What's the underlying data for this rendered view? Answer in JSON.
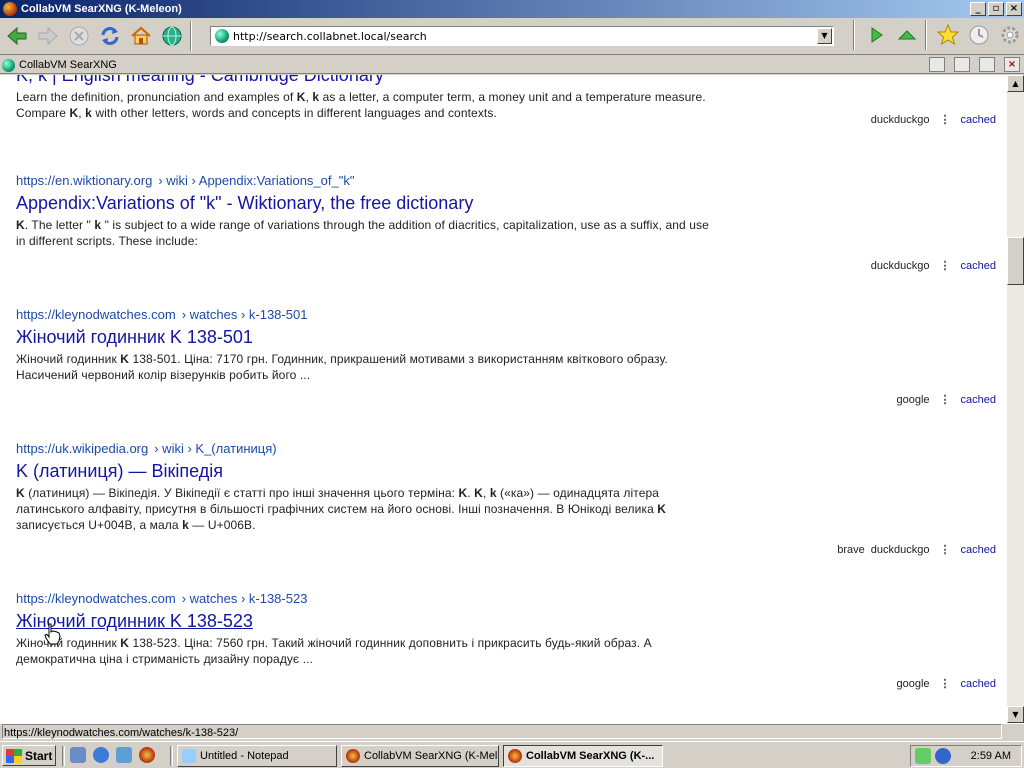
{
  "window": {
    "title": "CollabVM SearXNG (K-Meleon)",
    "controls": [
      "_",
      "▫",
      "×"
    ]
  },
  "toolbar": {
    "url": "http://search.collabnet.local/search"
  },
  "tab": {
    "label": "CollabVM SearXNG"
  },
  "results": [
    {
      "title": "K, k | English meaning - Cambridge Dictionary",
      "snippet_html": "Learn the definition, pronunciation and examples of <b>K</b>, <b>k</b> as a letter, a computer term, a money unit and a temperature measure. Compare <b>K</b>, <b>k</b> with other letters, words and concepts in different languages and contexts.",
      "engines": [
        "duckduckgo"
      ],
      "cached": "cached"
    },
    {
      "url": "https://en.wiktionary.org",
      "crumbs": "› wiki › Appendix:Variations_of_\"k\"",
      "title": "Appendix:Variations of \"k\" - Wiktionary, the free dictionary",
      "snippet_html": "<b>K</b>. The letter \" <b>k</b> \" is subject to a wide range of variations through the addition of diacritics, capitalization, use as a suffix, and use in different scripts. These include:",
      "engines": [
        "duckduckgo"
      ],
      "cached": "cached"
    },
    {
      "url": "https://kleynodwatches.com",
      "crumbs": "› watches › k-138-501",
      "title": "Жіночий годинник K 138-501",
      "snippet_html": "Жіночий годинник <b>K</b> 138-501. Ціна: 7170 грн. Годинник, прикрашений мотивами з використанням квіткового образу. Насичений червоний колір візерунків робить його ...",
      "engines": [
        "google"
      ],
      "cached": "cached"
    },
    {
      "url": "https://uk.wikipedia.org",
      "crumbs": "› wiki › K_(латиниця)",
      "title": "K (латиниця) — Вікіпедія",
      "snippet_html": "<b>K</b> (латиниця) — Вікіпедія. У Вікіпедії є статті про інші значення цього терміна: <b>K</b>. <b>K</b>, <b>k</b> («ка») — одинадцята літера латинського алфавіту, присутня в більшості графічних систем на його основі. Інші позначення. В Юнікоді велика <b>K</b> записується U+004B, а мала <b>k</b> — U+006B.",
      "engines": [
        "brave",
        "duckduckgo"
      ],
      "cached": "cached"
    },
    {
      "url": "https://kleynodwatches.com",
      "crumbs": "› watches › k-138-523",
      "title": "Жіночий годинник K 138-523",
      "snippet_html": "Жіночий годинник <b>K</b> 138-523. Ціна: 7560 грн. Такий жіночий годинник доповнить і прикрасить будь-який образ. А демократична ціна і стриманість дизайну порадує ...",
      "engines": [
        "google"
      ],
      "cached": "cached"
    }
  ],
  "statusbar": {
    "text": "https://kleynodwatches.com/watches/k-138-523/"
  },
  "taskbar": {
    "start_label": "Start",
    "buttons": [
      {
        "label": "Untitled - Notepad"
      },
      {
        "label": "CollabVM SearXNG (K-Mel..."
      },
      {
        "label": "CollabVM SearXNG (K-..."
      }
    ],
    "clock": "2:59 AM"
  },
  "colors": {
    "link_title": "#1414a6",
    "url": "#1a4ba8",
    "titlebar_start": "#0a246a",
    "titlebar_end": "#a6caf0"
  },
  "icons": [
    "back-icon",
    "forward-icon",
    "stop-icon",
    "reload-icon",
    "home-icon",
    "globe-icon",
    "go-icon",
    "up-icon",
    "bookmark-star-icon",
    "history-icon",
    "settings-icon"
  ]
}
